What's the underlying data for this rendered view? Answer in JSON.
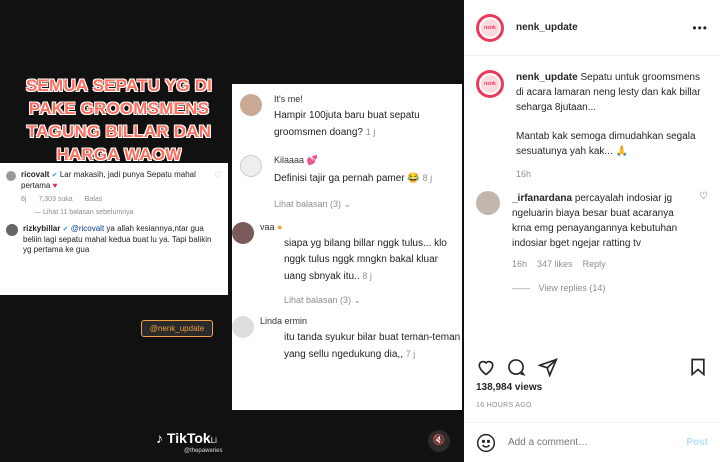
{
  "post_media": {
    "banner_text": "SEMUA SEPATU YG DI PAKE GROOMSMENS TAGUNG BILLAR DAN HARGA WAOW",
    "card_a": {
      "comment1": {
        "user": "ricovalt",
        "text": "Lar makasih, jadi punya Sepatu mahal pertama",
        "meta_time": "8j",
        "meta_likes": "7,303 suka",
        "meta_reply": "Balas"
      },
      "view_prev": "Lihat 11 balasan sebelumnya",
      "comment2": {
        "user": "rizkybillar",
        "mention": "@ricovalt",
        "text": "ya allah kesiannya,ntar gua beliin lagi sepatu mahal kedua buat lu ya. Tapi balikin yg pertama ke gua"
      }
    },
    "card_b": {
      "comments": [
        {
          "name": "It's me!",
          "text": "Hampir 100juta baru buat sepatu groomsmen doang?",
          "time": "1 j"
        },
        {
          "name": "Kilaaaa",
          "text": "Definisi tajir ga pernah pamer",
          "time": "8 j",
          "replies": "Lihat balasan (3)"
        },
        {
          "name": "vaa",
          "text": "siapa yg bilang billar nggk tulus... klo nggk tulus nggk mngkn bakal kluar uang sbnyak itu..",
          "time": "8 j",
          "replies": "Lihat balasan (3)"
        },
        {
          "name": "Linda ermin",
          "text": "itu tanda syukur bilar buat teman-teman yang sellu ngedukung dia,,",
          "time": "7 j"
        }
      ]
    },
    "watermark": "@nenk_update",
    "tiktok_label": "TikTok",
    "tiktok_suffix": "Li",
    "tiktok_user": "@thepaweries"
  },
  "sidebar": {
    "header_username": "nenk_update",
    "caption": {
      "username": "nenk_update",
      "text": "Sepatu untuk groomsmens di acara lamaran neng lesty dan kak billar seharga 8jutaan...",
      "text2": "Mantab kak semoga dimudahkan segala sesuatunya yah kak... 🙏",
      "time": "16h"
    },
    "comment": {
      "username": "_irfanardana",
      "text": "percayalah indosiar jg ngeluarin biaya besar buat acaranya krna emg penayangannya kebutuhan indosiar bget ngejar ratting tv",
      "time": "16h",
      "likes": "347 likes",
      "reply": "Reply",
      "view_replies": "View replies (14)"
    },
    "likes": "138,984 views",
    "date": "16 HOURS AGO",
    "add_comment_placeholder": "Add a comment…",
    "post_label": "Post"
  }
}
